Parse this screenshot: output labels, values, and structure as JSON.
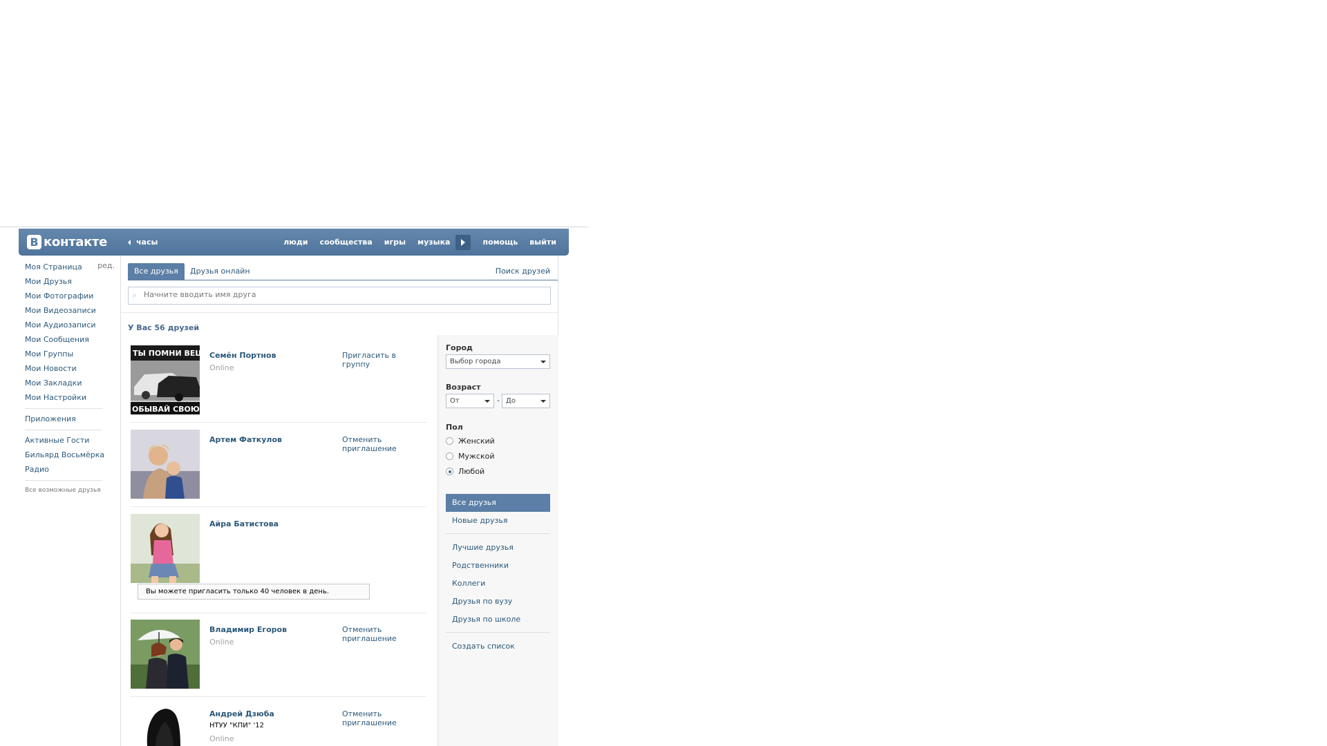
{
  "header": {
    "logo_letter": "В",
    "logo_text": "контакте",
    "clock": "часы",
    "nav": [
      "люди",
      "сообщества",
      "игры",
      "музыка",
      "помощь",
      "выйти"
    ]
  },
  "left_menu": {
    "items": [
      "Моя Страница",
      "Мои Друзья",
      "Мои Фотографии",
      "Мои Видеозаписи",
      "Мои Аудиозаписи",
      "Мои Сообщения",
      "Мои Группы",
      "Мои Новости",
      "Мои Закладки",
      "Мои Настройки"
    ],
    "edit": "ред.",
    "apps": "Приложения",
    "apps_list": [
      "Активные Гости",
      "Бильярд Восьмёрка",
      "Радио"
    ],
    "small_link": "Все возможные друзья"
  },
  "tabs": {
    "all": "Все друзья",
    "online": "Друзья онлайн",
    "search": "Поиск друзей"
  },
  "search": {
    "placeholder": "Начните вводить имя друга"
  },
  "friends_count": "У Вас 56 друзей",
  "friends": [
    {
      "name": "Семён Портнов",
      "status": "Online",
      "action": "Пригласить в группу",
      "photo_text_top": "ТЫ ПОМНИ ВЕЩ",
      "photo_text_bottom": "ОБЫВАЙ СВОЮ БРА"
    },
    {
      "name": "Артем Фаткулов",
      "status": "",
      "action": "Отменить приглашение"
    },
    {
      "name": "Айра Батистова",
      "status": "",
      "action": ""
    },
    {
      "name": "Владимир Егоров",
      "status": "Online",
      "action": "Отменить приглашение"
    },
    {
      "name": "Андрей Дзюба",
      "info": "НТУУ \"КПИ\" '12",
      "status": "Online",
      "action": "Отменить приглашение"
    }
  ],
  "notice": "Вы можете пригласить только 40 человек в день.",
  "filters": {
    "city_label": "Город",
    "city_select": "Выбор города",
    "age_label": "Возраст",
    "age_from": "От",
    "age_dash": "-",
    "age_to": "До",
    "sex_label": "Пол",
    "sex_options": [
      "Женский",
      "Мужской",
      "Любой"
    ],
    "sex_selected": 2,
    "lists": [
      "Все друзья",
      "Новые друзья",
      "Лучшие друзья",
      "Родственники",
      "Коллеги",
      "Друзья по вузу",
      "Друзья по школе",
      "Создать список"
    ]
  },
  "colors": {
    "header": "#597da3",
    "link": "#2b587a",
    "accent": "#5b7fa6"
  }
}
